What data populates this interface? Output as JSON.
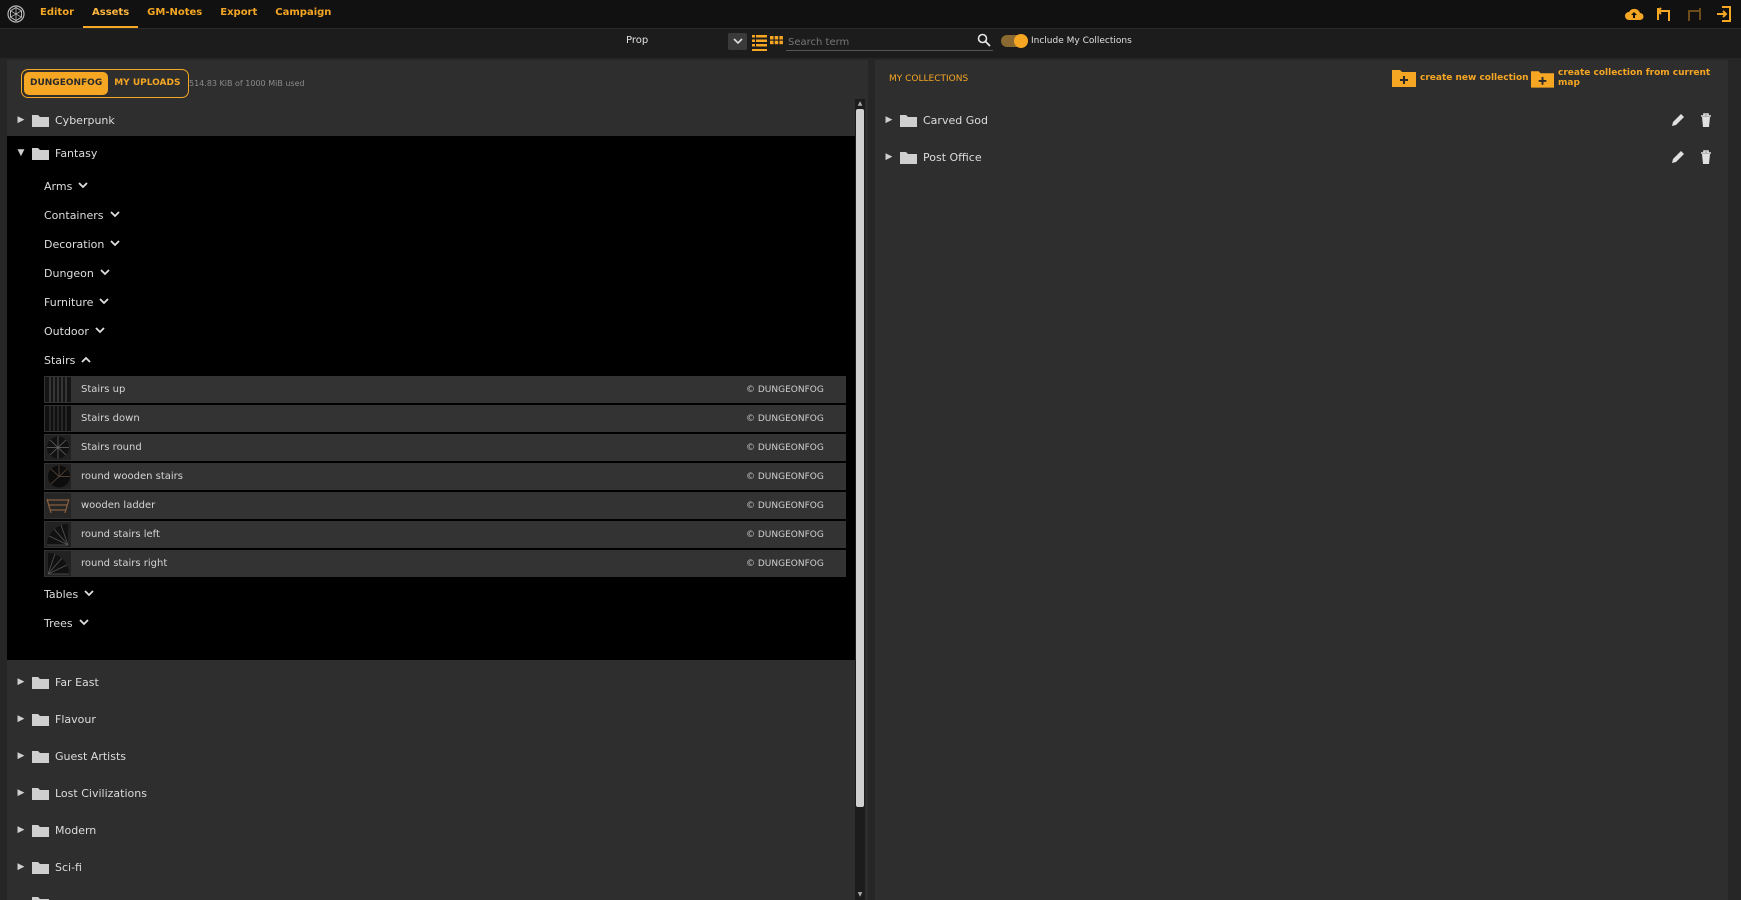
{
  "nav": {
    "items": [
      "Editor",
      "Assets",
      "GM-Notes",
      "Export",
      "Campaign"
    ],
    "active": "Assets"
  },
  "toolbar": {
    "title": "Prop",
    "search_placeholder": "Search term",
    "include_label": "Include My Collections",
    "include_on": true
  },
  "left": {
    "tabs": [
      "DUNGEONFOG",
      "MY UPLOADS"
    ],
    "storage": "514.83 KiB of 1000 MiB used",
    "folders_top": [
      "Cyberpunk",
      "Fantasy"
    ],
    "fantasy_sub": [
      "Arms",
      "Containers",
      "Decoration",
      "Dungeon",
      "Furniture",
      "Outdoor",
      "Stairs"
    ],
    "assets": [
      {
        "name": "Stairs up",
        "copy": "© DUNGEONFOG",
        "thumb": "stairs"
      },
      {
        "name": "Stairs down",
        "copy": "© DUNGEONFOG",
        "thumb": "stairs"
      },
      {
        "name": "Stairs round",
        "copy": "© DUNGEONFOG",
        "thumb": "round"
      },
      {
        "name": "round wooden stairs",
        "copy": "© DUNGEONFOG",
        "thumb": "round"
      },
      {
        "name": "wooden ladder",
        "copy": "© DUNGEONFOG",
        "thumb": "ladder"
      },
      {
        "name": "round stairs left",
        "copy": "© DUNGEONFOG",
        "thumb": "fan"
      },
      {
        "name": "round stairs right",
        "copy": "© DUNGEONFOG",
        "thumb": "fan"
      }
    ],
    "fantasy_sub_after": [
      "Tables",
      "Trees"
    ],
    "folders_bottom": [
      "Far East",
      "Flavour",
      "Guest Artists",
      "Lost Civilizations",
      "Modern",
      "Sci-fi"
    ]
  },
  "right": {
    "title": "MY COLLECTIONS",
    "create_new": "create new collection",
    "create_from_map": "create collection from current map",
    "collections": [
      "Carved God",
      "Post Office"
    ]
  },
  "colors": {
    "accent": "#f5a623",
    "panel": "#2e2e2e",
    "black": "#000000"
  }
}
